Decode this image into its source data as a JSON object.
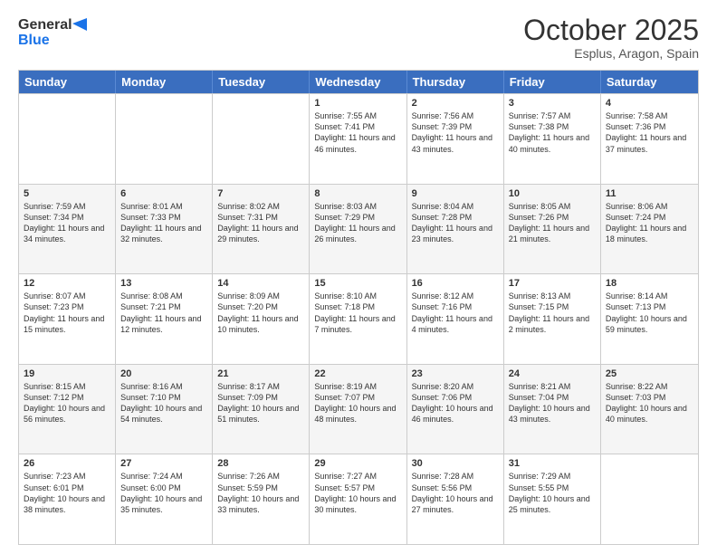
{
  "header": {
    "logo_line1": "General",
    "logo_line2": "Blue",
    "month": "October 2025",
    "location": "Esplus, Aragon, Spain"
  },
  "days_of_week": [
    "Sunday",
    "Monday",
    "Tuesday",
    "Wednesday",
    "Thursday",
    "Friday",
    "Saturday"
  ],
  "weeks": [
    [
      {
        "day": "",
        "sunrise": "",
        "sunset": "",
        "daylight": ""
      },
      {
        "day": "",
        "sunrise": "",
        "sunset": "",
        "daylight": ""
      },
      {
        "day": "",
        "sunrise": "",
        "sunset": "",
        "daylight": ""
      },
      {
        "day": "1",
        "sunrise": "Sunrise: 7:55 AM",
        "sunset": "Sunset: 7:41 PM",
        "daylight": "Daylight: 11 hours and 46 minutes."
      },
      {
        "day": "2",
        "sunrise": "Sunrise: 7:56 AM",
        "sunset": "Sunset: 7:39 PM",
        "daylight": "Daylight: 11 hours and 43 minutes."
      },
      {
        "day": "3",
        "sunrise": "Sunrise: 7:57 AM",
        "sunset": "Sunset: 7:38 PM",
        "daylight": "Daylight: 11 hours and 40 minutes."
      },
      {
        "day": "4",
        "sunrise": "Sunrise: 7:58 AM",
        "sunset": "Sunset: 7:36 PM",
        "daylight": "Daylight: 11 hours and 37 minutes."
      }
    ],
    [
      {
        "day": "5",
        "sunrise": "Sunrise: 7:59 AM",
        "sunset": "Sunset: 7:34 PM",
        "daylight": "Daylight: 11 hours and 34 minutes."
      },
      {
        "day": "6",
        "sunrise": "Sunrise: 8:01 AM",
        "sunset": "Sunset: 7:33 PM",
        "daylight": "Daylight: 11 hours and 32 minutes."
      },
      {
        "day": "7",
        "sunrise": "Sunrise: 8:02 AM",
        "sunset": "Sunset: 7:31 PM",
        "daylight": "Daylight: 11 hours and 29 minutes."
      },
      {
        "day": "8",
        "sunrise": "Sunrise: 8:03 AM",
        "sunset": "Sunset: 7:29 PM",
        "daylight": "Daylight: 11 hours and 26 minutes."
      },
      {
        "day": "9",
        "sunrise": "Sunrise: 8:04 AM",
        "sunset": "Sunset: 7:28 PM",
        "daylight": "Daylight: 11 hours and 23 minutes."
      },
      {
        "day": "10",
        "sunrise": "Sunrise: 8:05 AM",
        "sunset": "Sunset: 7:26 PM",
        "daylight": "Daylight: 11 hours and 21 minutes."
      },
      {
        "day": "11",
        "sunrise": "Sunrise: 8:06 AM",
        "sunset": "Sunset: 7:24 PM",
        "daylight": "Daylight: 11 hours and 18 minutes."
      }
    ],
    [
      {
        "day": "12",
        "sunrise": "Sunrise: 8:07 AM",
        "sunset": "Sunset: 7:23 PM",
        "daylight": "Daylight: 11 hours and 15 minutes."
      },
      {
        "day": "13",
        "sunrise": "Sunrise: 8:08 AM",
        "sunset": "Sunset: 7:21 PM",
        "daylight": "Daylight: 11 hours and 12 minutes."
      },
      {
        "day": "14",
        "sunrise": "Sunrise: 8:09 AM",
        "sunset": "Sunset: 7:20 PM",
        "daylight": "Daylight: 11 hours and 10 minutes."
      },
      {
        "day": "15",
        "sunrise": "Sunrise: 8:10 AM",
        "sunset": "Sunset: 7:18 PM",
        "daylight": "Daylight: 11 hours and 7 minutes."
      },
      {
        "day": "16",
        "sunrise": "Sunrise: 8:12 AM",
        "sunset": "Sunset: 7:16 PM",
        "daylight": "Daylight: 11 hours and 4 minutes."
      },
      {
        "day": "17",
        "sunrise": "Sunrise: 8:13 AM",
        "sunset": "Sunset: 7:15 PM",
        "daylight": "Daylight: 11 hours and 2 minutes."
      },
      {
        "day": "18",
        "sunrise": "Sunrise: 8:14 AM",
        "sunset": "Sunset: 7:13 PM",
        "daylight": "Daylight: 10 hours and 59 minutes."
      }
    ],
    [
      {
        "day": "19",
        "sunrise": "Sunrise: 8:15 AM",
        "sunset": "Sunset: 7:12 PM",
        "daylight": "Daylight: 10 hours and 56 minutes."
      },
      {
        "day": "20",
        "sunrise": "Sunrise: 8:16 AM",
        "sunset": "Sunset: 7:10 PM",
        "daylight": "Daylight: 10 hours and 54 minutes."
      },
      {
        "day": "21",
        "sunrise": "Sunrise: 8:17 AM",
        "sunset": "Sunset: 7:09 PM",
        "daylight": "Daylight: 10 hours and 51 minutes."
      },
      {
        "day": "22",
        "sunrise": "Sunrise: 8:19 AM",
        "sunset": "Sunset: 7:07 PM",
        "daylight": "Daylight: 10 hours and 48 minutes."
      },
      {
        "day": "23",
        "sunrise": "Sunrise: 8:20 AM",
        "sunset": "Sunset: 7:06 PM",
        "daylight": "Daylight: 10 hours and 46 minutes."
      },
      {
        "day": "24",
        "sunrise": "Sunrise: 8:21 AM",
        "sunset": "Sunset: 7:04 PM",
        "daylight": "Daylight: 10 hours and 43 minutes."
      },
      {
        "day": "25",
        "sunrise": "Sunrise: 8:22 AM",
        "sunset": "Sunset: 7:03 PM",
        "daylight": "Daylight: 10 hours and 40 minutes."
      }
    ],
    [
      {
        "day": "26",
        "sunrise": "Sunrise: 7:23 AM",
        "sunset": "Sunset: 6:01 PM",
        "daylight": "Daylight: 10 hours and 38 minutes."
      },
      {
        "day": "27",
        "sunrise": "Sunrise: 7:24 AM",
        "sunset": "Sunset: 6:00 PM",
        "daylight": "Daylight: 10 hours and 35 minutes."
      },
      {
        "day": "28",
        "sunrise": "Sunrise: 7:26 AM",
        "sunset": "Sunset: 5:59 PM",
        "daylight": "Daylight: 10 hours and 33 minutes."
      },
      {
        "day": "29",
        "sunrise": "Sunrise: 7:27 AM",
        "sunset": "Sunset: 5:57 PM",
        "daylight": "Daylight: 10 hours and 30 minutes."
      },
      {
        "day": "30",
        "sunrise": "Sunrise: 7:28 AM",
        "sunset": "Sunset: 5:56 PM",
        "daylight": "Daylight: 10 hours and 27 minutes."
      },
      {
        "day": "31",
        "sunrise": "Sunrise: 7:29 AM",
        "sunset": "Sunset: 5:55 PM",
        "daylight": "Daylight: 10 hours and 25 minutes."
      },
      {
        "day": "",
        "sunrise": "",
        "sunset": "",
        "daylight": ""
      }
    ]
  ]
}
